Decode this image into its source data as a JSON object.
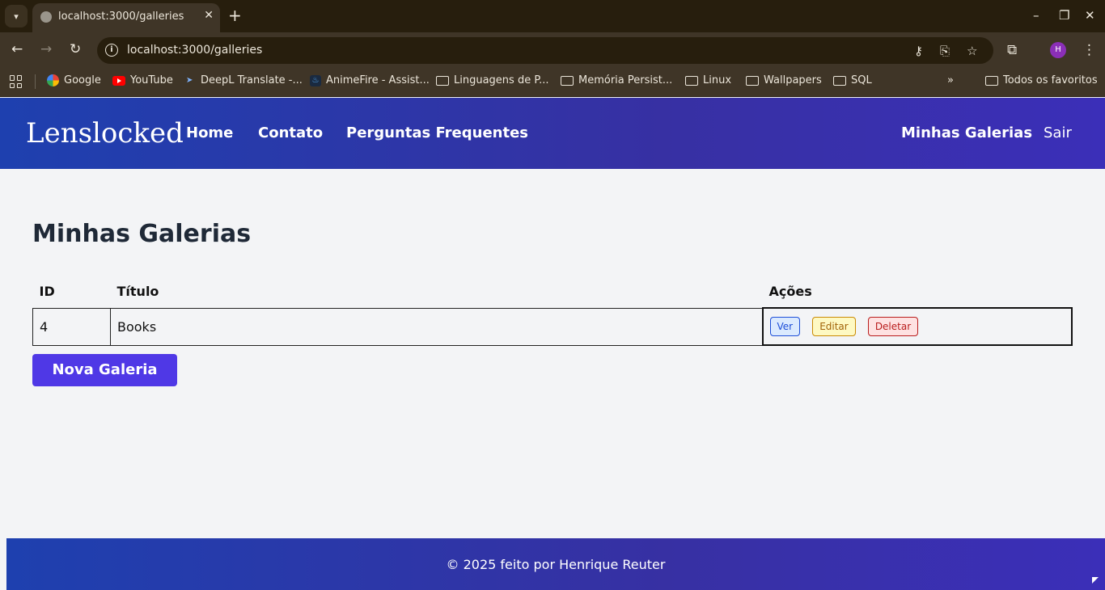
{
  "browser": {
    "tab_title": "localhost:3000/galleries",
    "url": "localhost:3000/galleries",
    "profile_initial": "H",
    "bookmarks": [
      {
        "label": "Google",
        "icon": "google-icon"
      },
      {
        "label": "YouTube",
        "icon": "youtube-icon"
      },
      {
        "label": "DeepL Translate -...",
        "icon": "deepl-icon"
      },
      {
        "label": "AnimeFire - Assist...",
        "icon": "animefire-icon"
      },
      {
        "label": "Linguagens de P...",
        "icon": "folder-icon"
      },
      {
        "label": "Memória Persist...",
        "icon": "folder-icon"
      },
      {
        "label": "Linux",
        "icon": "folder-icon"
      },
      {
        "label": "Wallpapers",
        "icon": "folder-icon"
      },
      {
        "label": "SQL",
        "icon": "folder-icon"
      }
    ],
    "all_bookmarks": "Todos os favoritos"
  },
  "navbar": {
    "brand": "Lenslocked",
    "links": [
      "Home",
      "Contato",
      "Perguntas Frequentes"
    ],
    "my_galleries": "Minhas Galerias",
    "logout": "Sair"
  },
  "main": {
    "title": "Minhas Galerias",
    "table": {
      "headers": [
        "ID",
        "Título",
        "Ações"
      ],
      "rows": [
        {
          "id": "4",
          "title": "Books"
        }
      ],
      "actions": {
        "view": "Ver",
        "edit": "Editar",
        "delete": "Deletar"
      }
    },
    "new_button": "Nova Galeria"
  },
  "footer": {
    "text": "© 2025 feito por Henrique Reuter"
  },
  "colors": {
    "navbar_gradient_start": "#1e40af",
    "navbar_gradient_end": "#3b2fb8",
    "primary_button": "#4f38e6",
    "page_background": "#f3f4f6"
  }
}
